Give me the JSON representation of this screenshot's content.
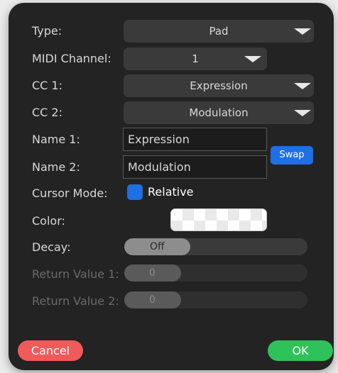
{
  "labels": {
    "type": "Type:",
    "midi_channel": "MIDI Channel:",
    "cc1": "CC 1:",
    "cc2": "CC 2:",
    "name1": "Name 1:",
    "name2": "Name 2:",
    "cursor_mode": "Cursor Mode:",
    "color": "Color:",
    "decay": "Decay:",
    "return_value_1": "Return Value 1:",
    "return_value_2": "Return Value 2:"
  },
  "type_select": {
    "value": "Pad"
  },
  "midi_channel_select": {
    "value": "1"
  },
  "cc1_select": {
    "value": "Expression"
  },
  "cc2_select": {
    "value": "Modulation"
  },
  "name1_field": {
    "value": "Expression"
  },
  "name2_field": {
    "value": "Modulation"
  },
  "swap_button": {
    "label": "Swap"
  },
  "cursor_mode": {
    "label": "Relative",
    "checked": true
  },
  "color_swatch": {
    "value": "transparent"
  },
  "decay_slider": {
    "value": "Off",
    "fill": 0.36
  },
  "return_value_1_slider": {
    "value": "0",
    "fill": 0.31
  },
  "return_value_2_slider": {
    "value": "0",
    "fill": 0.31
  },
  "cancel_button": {
    "label": "Cancel"
  },
  "ok_button": {
    "label": "OK"
  },
  "colors": {
    "accent_blue": "#1f6fe5",
    "cancel_red": "#f05a5a",
    "ok_green": "#2fc25a",
    "dialog_bg": "#232323"
  },
  "icons": {
    "dropdown_arrow": "chevron-down-icon",
    "checkbox": "checkbox-icon"
  }
}
